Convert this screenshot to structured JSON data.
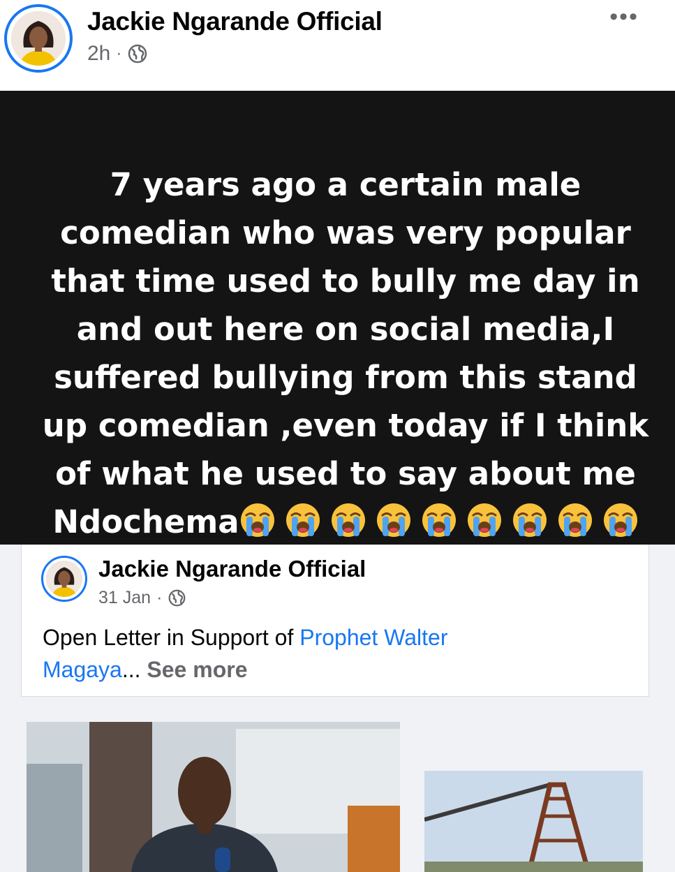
{
  "post": {
    "author": "Jackie Ngarande Official",
    "time": "2h",
    "separator": "·",
    "more_label": "•••",
    "status_lines": [
      "7 years ago a certain male",
      "comedian who was very popular",
      "that time used to bully me day in",
      "and out here on social media,I",
      "suffered bullying from this stand",
      "up comedian ,even today if I think",
      "of what he used to say about me",
      "Ndochema"
    ],
    "emoji_name": "loudly-crying-face",
    "emoji_count": 9
  },
  "shared": {
    "author": "Jackie Ngarande Official",
    "date": "31 Jan",
    "separator": "·",
    "text_prefix": "Open Letter in Support of ",
    "mention_part1": "Prophet Walter",
    "mention_part2": "Magaya",
    "ellipsis": "...",
    "see_more": "See more"
  },
  "icons": {
    "audience": "globe-icon",
    "more": "more-horizontal-icon"
  },
  "colors": {
    "accent": "#1877f2",
    "status_background": "#141414",
    "meta_text": "#65676b"
  }
}
